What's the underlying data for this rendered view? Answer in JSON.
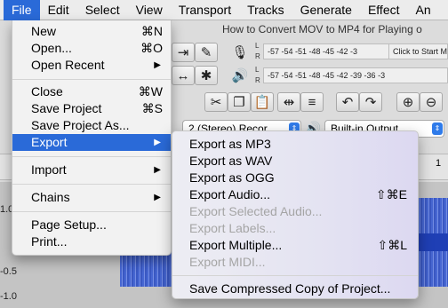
{
  "menubar": {
    "items": [
      "File",
      "Edit",
      "Select",
      "View",
      "Transport",
      "Tracks",
      "Generate",
      "Effect",
      "An"
    ]
  },
  "app": {
    "doc_title": "How to Convert MOV to MP4 for Playing o",
    "meter_top": "-57 -54 -51 -48 -45 -42 -3",
    "meter_top_hint": "Click to Start M",
    "meter_bottom": "-57 -54 -51 -48 -45 -42 -39 -36 -3",
    "lr_left": "L",
    "lr_right": "R",
    "channels_combo": "2 (Stereo) Recor...",
    "output_combo": "Built-in Output",
    "ruler_ticks": [
      "1",
      "1",
      "1"
    ],
    "scale_labels": [
      "1.0",
      "-0.5",
      "-1.0"
    ]
  },
  "file_menu": {
    "items": [
      {
        "label": "New",
        "shortcut": "⌘N"
      },
      {
        "label": "Open...",
        "shortcut": "⌘O"
      },
      {
        "label": "Open Recent",
        "shortcut": "▶"
      },
      {
        "label": "Close",
        "shortcut": "⌘W"
      },
      {
        "label": "Save Project",
        "shortcut": "⌘S"
      },
      {
        "label": "Save Project As...",
        "shortcut": ""
      },
      {
        "label": "Export",
        "shortcut": "▶"
      },
      {
        "label": "Import",
        "shortcut": "▶"
      },
      {
        "label": "Chains",
        "shortcut": "▶"
      },
      {
        "label": "Page Setup...",
        "shortcut": ""
      },
      {
        "label": "Print...",
        "shortcut": ""
      }
    ]
  },
  "export_menu": {
    "items": [
      {
        "label": "Export as MP3",
        "shortcut": ""
      },
      {
        "label": "Export as WAV",
        "shortcut": ""
      },
      {
        "label": "Export as OGG",
        "shortcut": ""
      },
      {
        "label": "Export Audio...",
        "shortcut": "⇧⌘E"
      },
      {
        "label": "Export Selected Audio...",
        "shortcut": ""
      },
      {
        "label": "Export Labels...",
        "shortcut": ""
      },
      {
        "label": "Export Multiple...",
        "shortcut": "⇧⌘L"
      },
      {
        "label": "Export MIDI...",
        "shortcut": ""
      },
      {
        "label": "Save Compressed Copy of Project...",
        "shortcut": ""
      }
    ]
  },
  "colors": {
    "highlight": "#2a6ad8",
    "waveform": "#3c5fd3"
  }
}
